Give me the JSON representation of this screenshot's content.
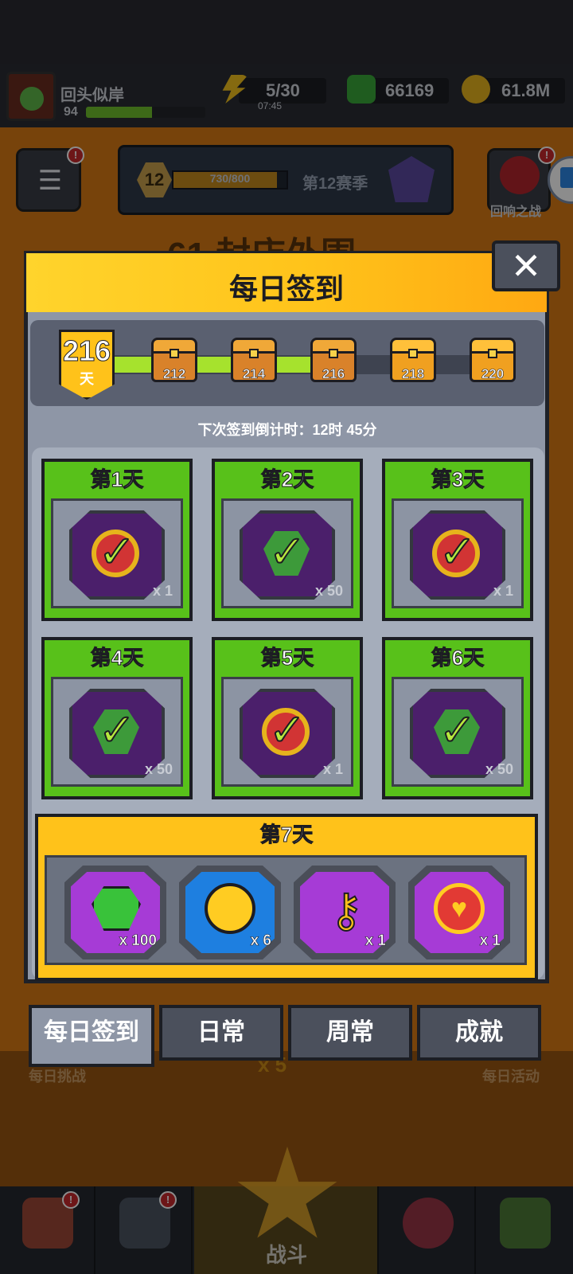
{
  "player": {
    "name": "回头似岸",
    "level": "94",
    "xp_fraction": 0.55
  },
  "resources": {
    "energy": "5/30",
    "energy_timer": "07:45",
    "gems": "66169",
    "coins": "61.8M"
  },
  "season": {
    "level": "12",
    "progress": "730/800",
    "progress_fraction": 0.9125,
    "name": "第12赛季"
  },
  "side_buttons": {
    "echo_battle": "回响之战",
    "menu_badge": "!",
    "echo_badge": "!"
  },
  "background_stage_title": "61 封店外围",
  "modal": {
    "title": "每日签到",
    "current_day": "216",
    "day_unit": "天",
    "track_fill_fraction": 0.58,
    "milestones": [
      {
        "label": "212",
        "claimed": true
      },
      {
        "label": "214",
        "claimed": true
      },
      {
        "label": "216",
        "claimed": true
      },
      {
        "label": "218",
        "claimed": false
      },
      {
        "label": "220",
        "claimed": false
      }
    ],
    "countdown": "下次签到倒计时：12时 45分",
    "days": [
      {
        "label": "第1天",
        "reward": "coin-icon",
        "qty": "x 1",
        "claimed": true
      },
      {
        "label": "第2天",
        "reward": "gem-icon",
        "qty": "x 50",
        "claimed": true
      },
      {
        "label": "第3天",
        "reward": "coin-icon",
        "qty": "x 1",
        "claimed": true
      },
      {
        "label": "第4天",
        "reward": "gem-icon",
        "qty": "x 50",
        "claimed": true
      },
      {
        "label": "第5天",
        "reward": "coin-icon",
        "qty": "x 1",
        "claimed": true
      },
      {
        "label": "第6天",
        "reward": "gem-icon",
        "qty": "x 50",
        "claimed": true
      }
    ],
    "day7": {
      "label": "第7天",
      "rewards": [
        {
          "icon": "gem-icon",
          "qty": "x 100",
          "color": "#a63bd6"
        },
        {
          "icon": "gold-coin-icon",
          "qty": "x 6",
          "color": "#1e7fe0"
        },
        {
          "icon": "key-icon",
          "qty": "x 1",
          "color": "#a63bd6"
        },
        {
          "icon": "heart-coin-icon",
          "qty": "x 1",
          "color": "#a63bd6"
        }
      ]
    }
  },
  "tabs": [
    "每日签到",
    "日常",
    "周常",
    "成就"
  ],
  "background_labels": {
    "daily_challenge": "每日挑战",
    "daily_event": "每日活动",
    "energy_cost": "x 5"
  },
  "bottom_nav": {
    "battle": "战斗"
  },
  "colors": {
    "accent_yellow": "#ffc21a",
    "claimed_green": "#58c11a",
    "modal_grey": "#8e96a6"
  }
}
